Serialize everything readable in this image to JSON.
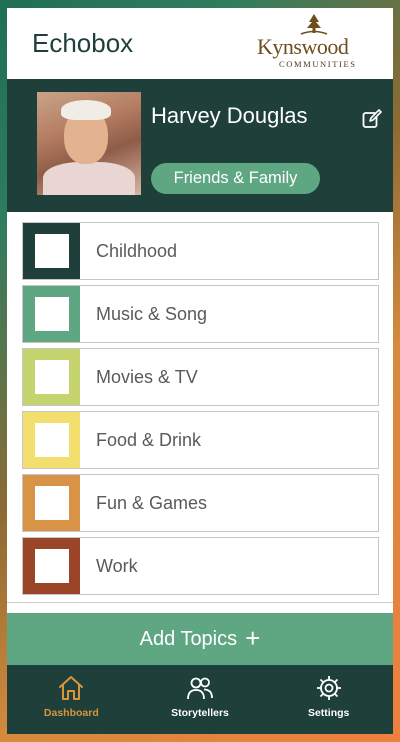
{
  "app": {
    "title": "Echobox"
  },
  "logo": {
    "word": "Kynswood",
    "sub": "COMMUNITIES"
  },
  "profile": {
    "name": "Harvey Douglas",
    "group": "Friends & Family"
  },
  "topics": [
    {
      "label": "Childhood",
      "color": "#1e3f3a"
    },
    {
      "label": "Music & Song",
      "color": "#5fa783"
    },
    {
      "label": "Movies & TV",
      "color": "#c5d46e"
    },
    {
      "label": "Food & Drink",
      "color": "#f3df6d"
    },
    {
      "label": "Fun & Games",
      "color": "#d89346"
    },
    {
      "label": "Work",
      "color": "#9a4428"
    }
  ],
  "actions": {
    "add_topics": "Add Topics",
    "add_icon": "+"
  },
  "nav": [
    {
      "label": "Dashboard",
      "icon": "home-icon",
      "active": true
    },
    {
      "label": "Storytellers",
      "icon": "people-icon",
      "active": false
    },
    {
      "label": "Settings",
      "icon": "gear-icon",
      "active": false
    }
  ],
  "colors": {
    "primary_dark": "#1e3f3a",
    "accent_green": "#5fa783",
    "active_nav": "#d9953c"
  }
}
